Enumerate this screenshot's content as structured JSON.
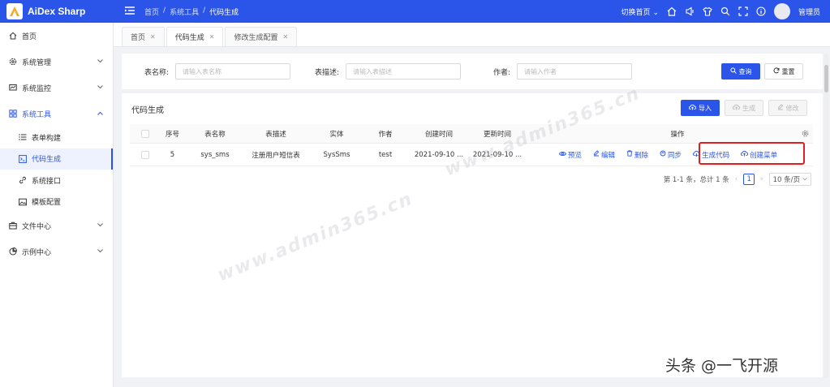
{
  "app": {
    "title": "AiDex Sharp"
  },
  "breadcrumb": [
    "首页",
    "/",
    "系统工具",
    "/",
    "代码生成"
  ],
  "header": {
    "switch_home": "切换首页",
    "user": "管理员"
  },
  "sidebar": {
    "items": [
      {
        "label": "首页",
        "icon": "home-icon"
      },
      {
        "label": "系统管理",
        "icon": "gear-icon"
      },
      {
        "label": "系统监控",
        "icon": "monitor-icon"
      },
      {
        "label": "系统工具",
        "icon": "grid-icon"
      },
      {
        "label": "文件中心",
        "icon": "folder-icon"
      },
      {
        "label": "示例中心",
        "icon": "pie-icon"
      }
    ],
    "sub_items": [
      {
        "label": "表单构建",
        "icon": "list-icon"
      },
      {
        "label": "代码生成",
        "icon": "code-icon"
      },
      {
        "label": "系统接口",
        "icon": "link-icon"
      },
      {
        "label": "模板配置",
        "icon": "image-icon"
      }
    ]
  },
  "tabs": [
    {
      "label": "首页"
    },
    {
      "label": "代码生成"
    },
    {
      "label": "修改生成配置"
    }
  ],
  "search": {
    "table_name_label": "表名称:",
    "table_name_placeholder": "请输入表名称",
    "table_desc_label": "表描述:",
    "table_desc_placeholder": "请输入表描述",
    "author_label": "作者:",
    "author_placeholder": "请输入作者",
    "query_button": "查询",
    "reset_button": "重置"
  },
  "main": {
    "title": "代码生成",
    "import_button": "导入",
    "generate_button": "生成",
    "edit_button": "修改"
  },
  "table": {
    "headers": [
      "序号",
      "表名称",
      "表描述",
      "实体",
      "作者",
      "创建时间",
      "更新时间",
      "操作"
    ],
    "rows": [
      {
        "index": "5",
        "table_name": "sys_sms",
        "table_desc": "注册用户短信表",
        "entity": "SysSms",
        "author": "test",
        "created": "2021-09-10 ...",
        "updated": "2021-09-10 ..."
      }
    ],
    "actions": [
      "预览",
      "编辑",
      "删除",
      "同步",
      "生成代码",
      "创建菜单"
    ]
  },
  "pagination": {
    "summary": "第 1-1 条，总计 1 条",
    "current_page": "1",
    "page_size": "10 条/页"
  },
  "watermark": "www.admin365.cn",
  "credit": "头条 @一飞开源",
  "colors": {
    "primary": "#2b55e8",
    "highlight": "#e02020"
  }
}
